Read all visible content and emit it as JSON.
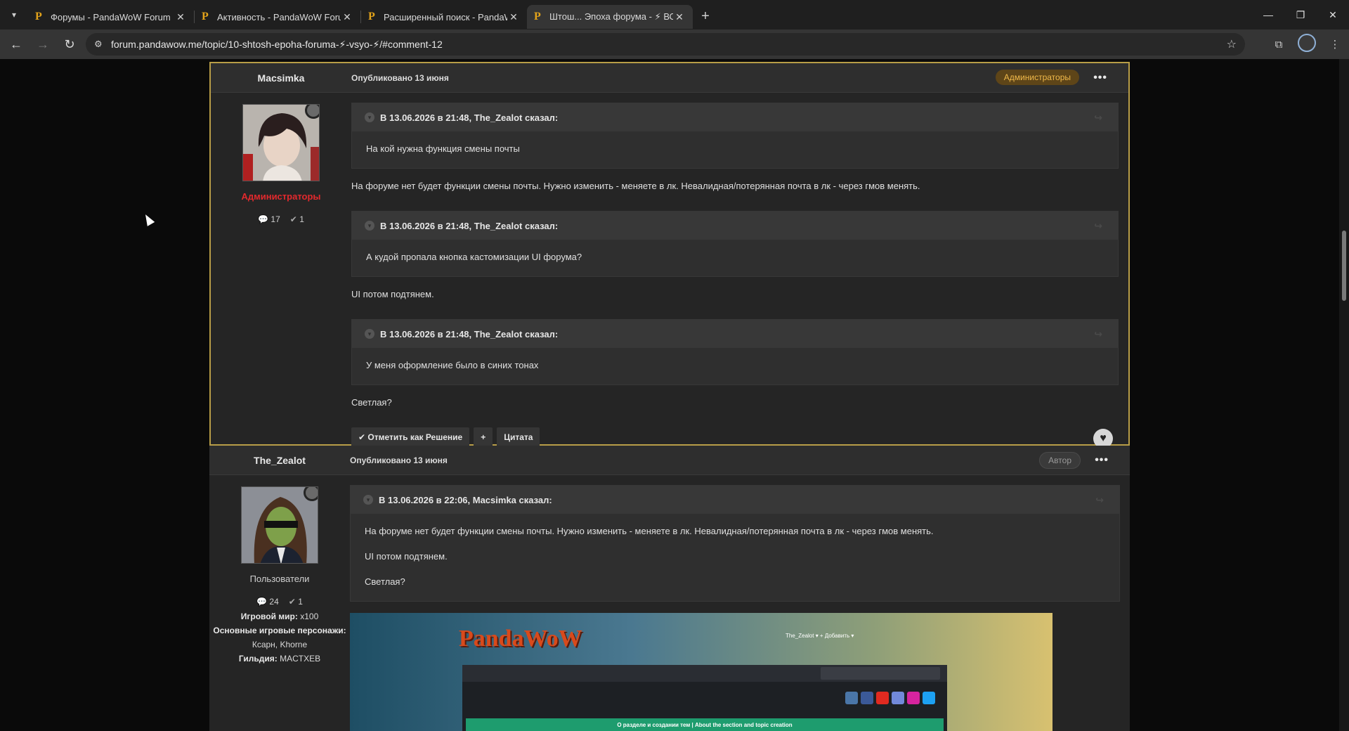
{
  "browser": {
    "tabs": [
      {
        "title": "Форумы - PandaWoW Forum",
        "active": false
      },
      {
        "title": "Активность - PandaWoW Forum",
        "active": false
      },
      {
        "title": "Расширенный поиск - PandaWoW",
        "active": false
      },
      {
        "title": "Штош... Эпоха форума - ⚡ ВС",
        "active": true
      }
    ],
    "favicon": "P",
    "url": "forum.pandawow.me/topic/10-shtosh-epoha-foruma-⚡-vsyo-⚡/#comment-12"
  },
  "posts": [
    {
      "author": "Macsimka",
      "published": "Опубликовано 13 июня",
      "badge": "Администраторы",
      "group": "Администраторы",
      "posts_count": "17",
      "solutions_count": "1",
      "quotes": [
        {
          "header": "В 13.06.2026 в 21:48, The_Zealot сказал:",
          "body": "На кой нужна функция смены почты",
          "reply": "На форуме нет будет функции смены почты. Нужно изменить - меняете в лк. Невалидная/потерянная почта в лк - через гмов менять."
        },
        {
          "header": "В 13.06.2026 в 21:48, The_Zealot сказал:",
          "body": "А кудой пропала кнопка кастомизации UI форума?",
          "reply": "UI потом подтянем."
        },
        {
          "header": "В 13.06.2026 в 21:48, The_Zealot сказал:",
          "body": "У меня оформление было в синих тонах",
          "reply": "Светлая?"
        }
      ],
      "actions": {
        "solution": "Отметить как Решение",
        "plus": "+",
        "quote": "Цитата"
      }
    },
    {
      "author": "The_Zealot",
      "published": "Опубликовано 13 июня",
      "badge": "Автор",
      "group": "Пользователи",
      "posts_count": "24",
      "solutions_count": "1",
      "fields": {
        "world_label": "Игровой мир:",
        "world_value": "x100",
        "chars_label": "Основные игровые персонажи:",
        "chars_value": "Ксарн, Khorne",
        "guild_label": "Гильдия:",
        "guild_value": "MACTXEB"
      },
      "quote": {
        "header": "В 13.06.2026 в 22:06, Macsimka сказал:",
        "lines": [
          "На форуме нет будет функции смены почты. Нужно изменить - меняете в лк. Невалидная/потерянная почта в лк - через гмов менять.",
          "UI потом подтянем.",
          "Светлая?"
        ]
      },
      "screenshot": {
        "logo": "PandaWoW",
        "user": "The_Zealot ▾   + Добавить ▾",
        "banner": "О разделе и создании тем | About the section and topic creation"
      }
    }
  ]
}
